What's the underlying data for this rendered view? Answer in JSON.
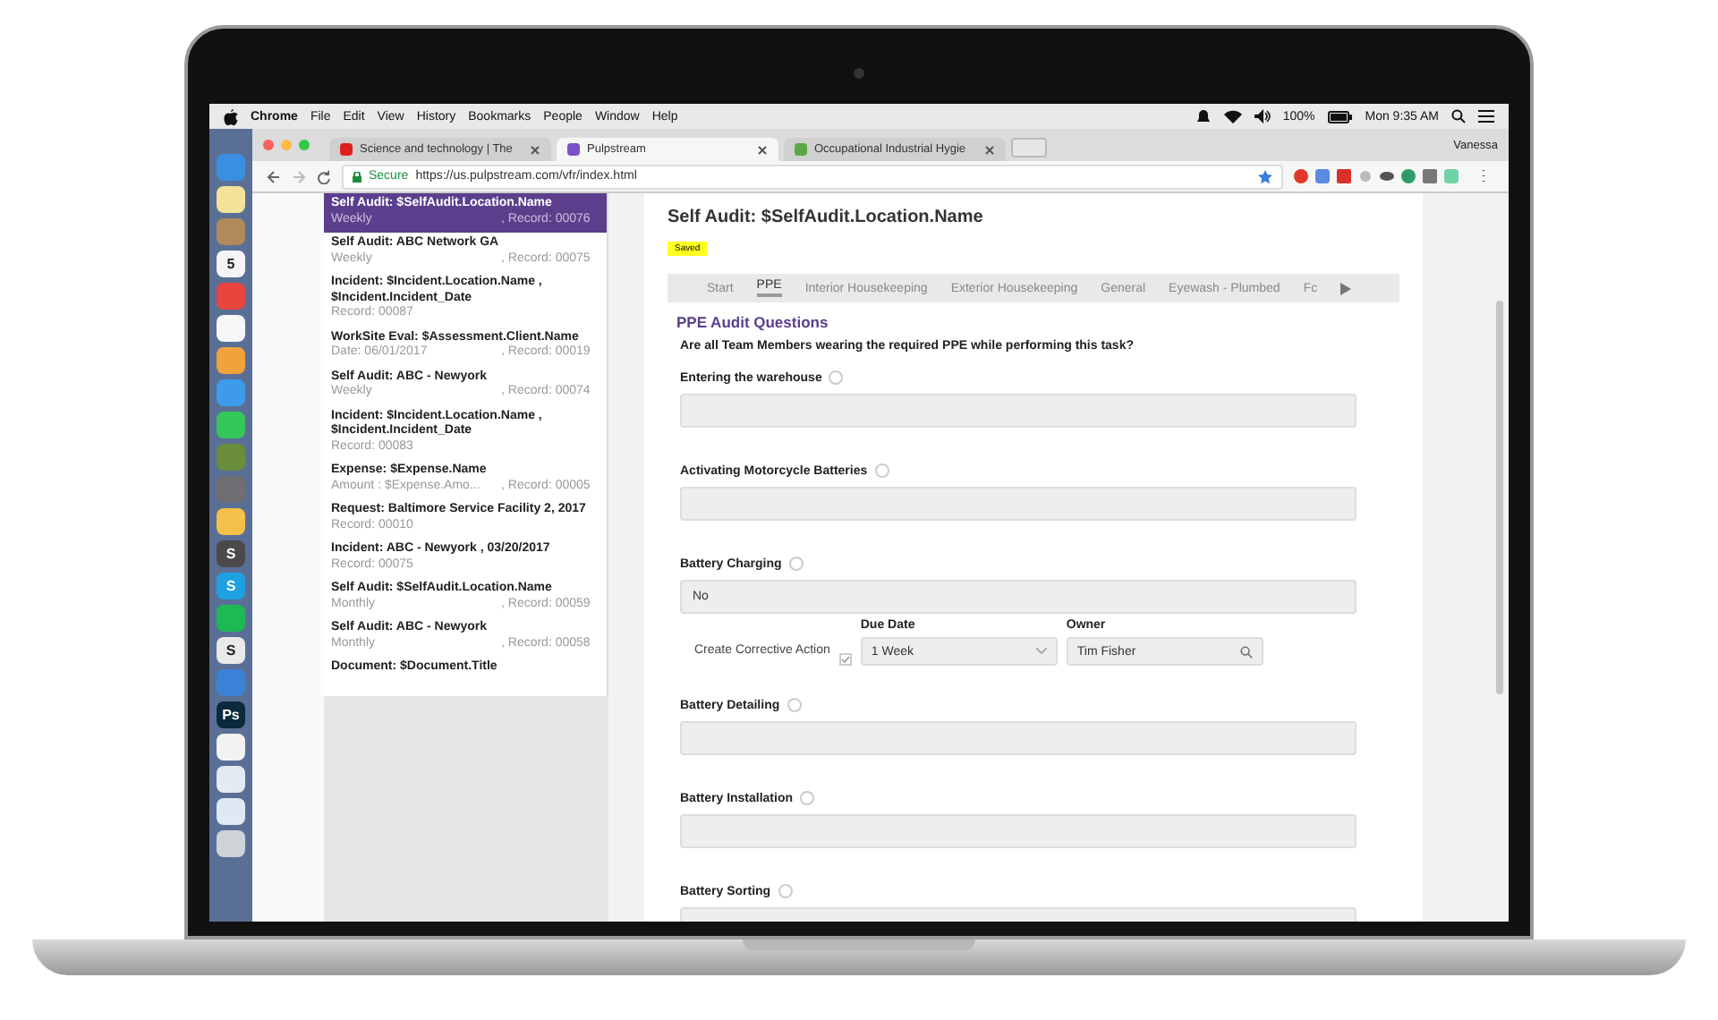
{
  "menubar": {
    "app": "Chrome",
    "menus": [
      "File",
      "Edit",
      "View",
      "History",
      "Bookmarks",
      "People",
      "Window",
      "Help"
    ],
    "battery": "100%",
    "clock": "Mon 9:35 AM"
  },
  "dock": [
    {
      "color": "#3b8fe0"
    },
    {
      "color": "#f3e39a"
    },
    {
      "color": "#b08a5a"
    },
    {
      "color": "#f4f4f4",
      "glyph": "5"
    },
    {
      "color": "#e8453c"
    },
    {
      "color": "#f7f7f7"
    },
    {
      "color": "#f0a23b"
    },
    {
      "color": "#3d9be9"
    },
    {
      "color": "#35c759"
    },
    {
      "color": "#6b8e3a"
    },
    {
      "color": "#6e6e73"
    },
    {
      "color": "#f5c04a"
    },
    {
      "color": "#4a4a4a",
      "glyph": "S"
    },
    {
      "color": "#1da1e2",
      "glyph": "S"
    },
    {
      "color": "#1db954"
    },
    {
      "color": "#e9e9e9",
      "glyph": "S"
    },
    {
      "color": "#3b82d6"
    },
    {
      "color": "#0a2a3d",
      "glyph": "Ps"
    },
    {
      "color": "#f2f2f2"
    },
    {
      "color": "#e4eaf2"
    },
    {
      "color": "#dfe8f5"
    },
    {
      "color": "#cfd3d8"
    }
  ],
  "browser": {
    "tabs": [
      {
        "title": "Science and technology | The",
        "selected": false,
        "color": "#e0201b"
      },
      {
        "title": "Pulpstream",
        "selected": true,
        "color": "#7b4fc9"
      },
      {
        "title": "Occupational Industrial Hygie",
        "selected": false,
        "color": "#5aa84a"
      }
    ],
    "user": "Vanessa",
    "secure": "Secure",
    "url": "https://us.pulpstream.com/vfr/index.html"
  },
  "sidebar": {
    "items": [
      {
        "title": "Self Audit: $SelfAudit.Location.Name",
        "detail": "Weekly",
        "record": ", Record: 00076",
        "selected": true
      },
      {
        "title": "Self Audit: ABC Network GA",
        "detail": "Weekly",
        "record": ", Record: 00075",
        "selected": false
      },
      {
        "title": "Incident: $Incident.Location.Name , $Incident.Incident_Date",
        "detail": "Record: 00087",
        "selected": false
      },
      {
        "title": "WorkSite Eval: $Assessment.Client.Name",
        "detail": "Date: 06/01/2017",
        "record": ", Record: 00019",
        "selected": false
      },
      {
        "title": "Self Audit: ABC - Newyork",
        "detail": "Weekly",
        "record": ", Record: 00074",
        "selected": false
      },
      {
        "title": "Incident: $Incident.Location.Name , $Incident.Incident_Date",
        "detail": "Record: 00083",
        "selected": false
      },
      {
        "title": "Expense: $Expense.Name",
        "detail": "Amount : $Expense.Amo...",
        "record": ", Record: 00005",
        "selected": false
      },
      {
        "title": "Request: Baltimore Service Facility 2, 2017",
        "detail": "Record: 00010",
        "selected": false
      },
      {
        "title": "Incident: ABC - Newyork , 03/20/2017",
        "detail": "Record: 00075",
        "selected": false
      },
      {
        "title": "Self Audit: $SelfAudit.Location.Name",
        "detail": "Monthly",
        "record": ", Record: 00059",
        "selected": false
      },
      {
        "title": "Self Audit: ABC - Newyork",
        "detail": "Monthly",
        "record": ", Record: 00058",
        "selected": false
      },
      {
        "title": "Document: $Document.Title",
        "selected": false
      }
    ]
  },
  "form": {
    "title": "Self Audit: $SelfAudit.Location.Name",
    "status": "Saved",
    "tabs": [
      {
        "label": "Start",
        "selected": false
      },
      {
        "label": "PPE",
        "selected": true
      },
      {
        "label": "Interior Housekeeping",
        "selected": false
      },
      {
        "label": "Exterior Housekeeping",
        "selected": false
      },
      {
        "label": "General",
        "selected": false
      },
      {
        "label": "Eyewash - Plumbed",
        "selected": false
      },
      {
        "label": "Fc",
        "selected": false
      }
    ],
    "section": "PPE Audit Questions",
    "prompt": "Are all Team Members wearing the required PPE while performing this task?",
    "questions": [
      {
        "label": "Entering the warehouse"
      },
      {
        "label": "Activating Motorcycle Batteries"
      },
      {
        "label": "Battery Charging",
        "value": "No",
        "action": {
          "label": "Create Corrective Action",
          "checked": true,
          "due_label": "Due Date",
          "due": "1 Week",
          "owner_label": "Owner",
          "owner": "Tim Fisher"
        }
      },
      {
        "label": "Battery Detailing"
      },
      {
        "label": "Battery Installation"
      },
      {
        "label": "Battery Sorting"
      }
    ]
  }
}
